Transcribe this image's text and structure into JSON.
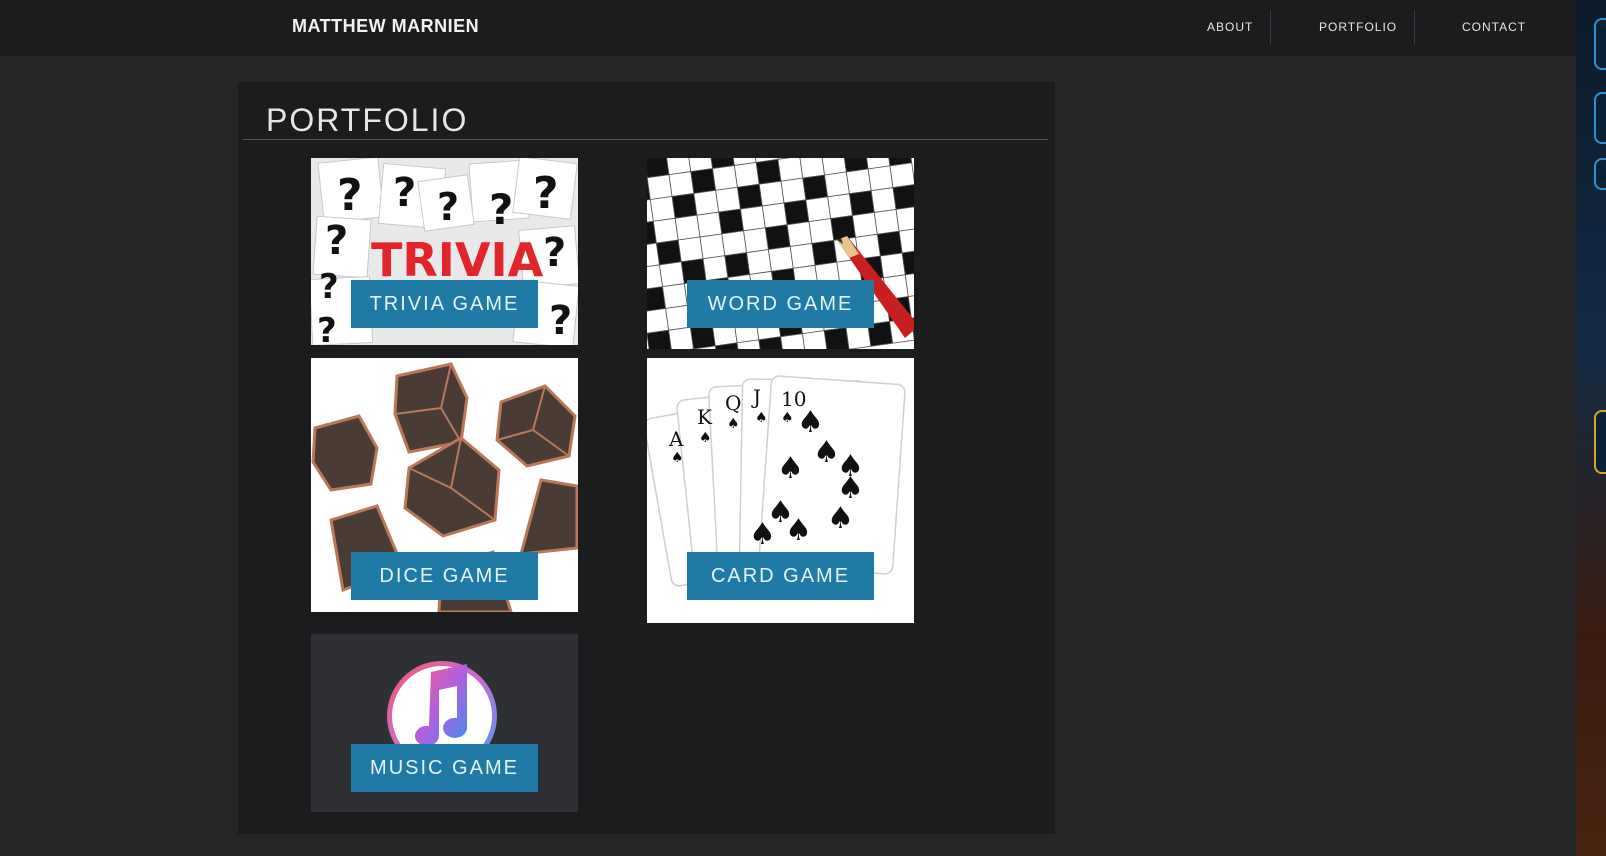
{
  "header": {
    "brand": "MATTHEW MARNIEN",
    "nav": [
      {
        "label": "ABOUT"
      },
      {
        "label": "PORTFOLIO"
      },
      {
        "label": "CONTACT"
      }
    ]
  },
  "portfolio": {
    "title": "PORTFOLIO",
    "tiles": [
      {
        "label": "TRIVIA GAME",
        "image_text": "TRIVIA"
      },
      {
        "label": "WORD GAME"
      },
      {
        "label": "DICE GAME"
      },
      {
        "label": "CARD GAME"
      },
      {
        "label": "MUSIC GAME"
      }
    ]
  },
  "colors": {
    "page_bg": "#262628",
    "panel_bg": "#1b1c1e",
    "label_bg": "#1f7aa6",
    "trivia_red": "#e0262b"
  }
}
